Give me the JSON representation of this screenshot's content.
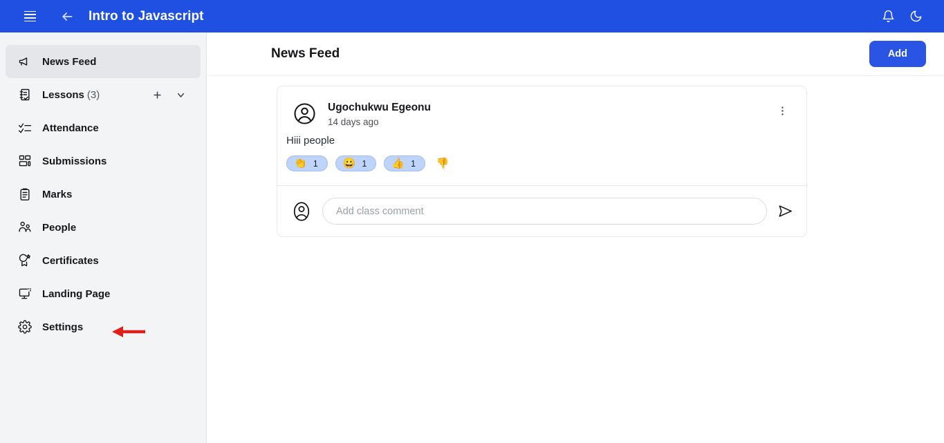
{
  "topbar": {
    "menu_icon": "hamburger-icon",
    "back_icon": "back-arrow-icon",
    "title": "Intro to Javascript",
    "notification_icon": "bell-icon",
    "theme_icon": "moon-icon",
    "background": "#2050E2"
  },
  "sidebar": {
    "items": [
      {
        "label": "News Feed",
        "icon": "megaphone-icon",
        "active": true,
        "count": ""
      },
      {
        "label": "Lessons",
        "icon": "lessons-icon",
        "active": false,
        "count": "(3)"
      },
      {
        "label": "Attendance",
        "icon": "attendance-icon",
        "active": false,
        "count": ""
      },
      {
        "label": "Submissions",
        "icon": "submissions-icon",
        "active": false,
        "count": ""
      },
      {
        "label": "Marks",
        "icon": "clipboard-icon",
        "active": false,
        "count": ""
      },
      {
        "label": "People",
        "icon": "people-icon",
        "active": false,
        "count": ""
      },
      {
        "label": "Certificates",
        "icon": "certificate-icon",
        "active": false,
        "count": ""
      },
      {
        "label": "Landing Page",
        "icon": "monitor-icon",
        "active": false,
        "count": ""
      },
      {
        "label": "Settings",
        "icon": "gear-icon",
        "active": false,
        "count": ""
      }
    ],
    "lessons_add_icon": "plus-icon",
    "lessons_expand_icon": "chevron-down-icon",
    "annotation": {
      "type": "arrow-left",
      "color": "#E01E1E",
      "points_to": "Landing Page"
    }
  },
  "main": {
    "title": "News Feed",
    "add_label": "Add",
    "add_color": "#2A54E4"
  },
  "post": {
    "avatar_icon": "user-avatar-icon",
    "author": "Ugochukwu Egeonu",
    "timestamp": "14 days ago",
    "text": "Hiii people",
    "more_icon": "more-vertical-icon",
    "reactions": [
      {
        "emoji": "👏",
        "name": "clap-reaction",
        "count": "1",
        "selected": true
      },
      {
        "emoji": "😀",
        "name": "smile-reaction",
        "count": "1",
        "selected": true
      },
      {
        "emoji": "👍",
        "name": "thumbs-up-reaction",
        "count": "1",
        "selected": true
      },
      {
        "emoji": "👎",
        "name": "thumbs-down-reaction",
        "count": "",
        "selected": false
      }
    ]
  },
  "comment": {
    "avatar_icon": "user-avatar-icon",
    "placeholder": "Add class comment",
    "value": "",
    "send_icon": "send-icon"
  }
}
